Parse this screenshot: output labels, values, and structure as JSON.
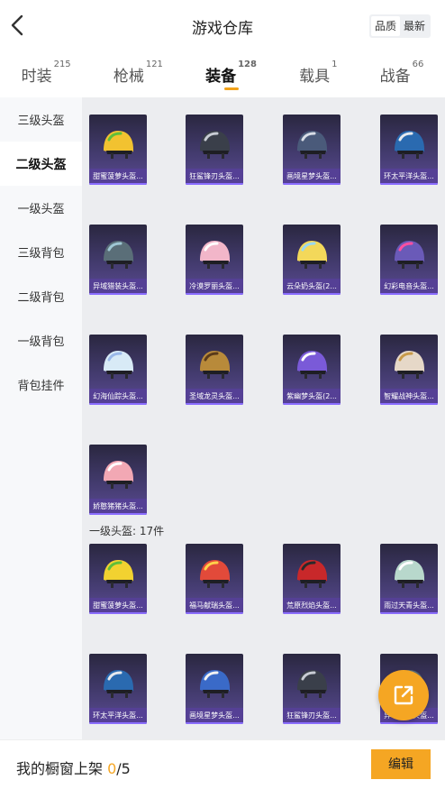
{
  "header": {
    "title": "游戏仓库",
    "sort": [
      {
        "label": "品质",
        "active": true
      },
      {
        "label": "最新",
        "active": false
      }
    ]
  },
  "tabs": [
    {
      "label": "时装",
      "count": "215",
      "active": false
    },
    {
      "label": "枪械",
      "count": "121",
      "active": false
    },
    {
      "label": "装备",
      "count": "128",
      "active": true
    },
    {
      "label": "载具",
      "count": "1",
      "active": false
    },
    {
      "label": "战备",
      "count": "66",
      "active": false
    }
  ],
  "sidebar": {
    "items": [
      {
        "label": "三级头盔",
        "active": false
      },
      {
        "label": "二级头盔",
        "active": true
      },
      {
        "label": "一级头盔",
        "active": false
      },
      {
        "label": "三级背包",
        "active": false
      },
      {
        "label": "二级背包",
        "active": false
      },
      {
        "label": "一级背包",
        "active": false
      },
      {
        "label": "背包挂件",
        "active": false
      }
    ]
  },
  "level2": {
    "items": [
      {
        "name": "甜蜜菠萝头盔...",
        "icon": "pineapple-helmet-icon",
        "color": "#f2c230",
        "accent": "#5fbf3a"
      },
      {
        "name": "狂鲨锋刃头盔...",
        "icon": "shark-helmet-icon",
        "color": "#3a3f4a",
        "accent": "#c8ccd4"
      },
      {
        "name": "画境星梦头盔...",
        "icon": "starry-helmet-icon",
        "color": "#4a5a7a",
        "accent": "#d8dde6"
      },
      {
        "name": "环太平洋头盔...",
        "icon": "pacific-helmet-icon",
        "color": "#2a6ab0",
        "accent": "#e6e9ee"
      },
      {
        "name": "异域猎装头盔...",
        "icon": "hunter-helmet-icon",
        "color": "#5a6e78",
        "accent": "#9fc7d4"
      },
      {
        "name": "冷漠罗丽头盔...",
        "icon": "lolita-helmet-icon",
        "color": "#f2b6c9",
        "accent": "#ffffff"
      },
      {
        "name": "云朵奶头盔(2...",
        "icon": "cloud-helmet-icon",
        "color": "#f3d85a",
        "accent": "#9ad8f0"
      },
      {
        "name": "幻彩电音头盔...",
        "icon": "neon-helmet-icon",
        "color": "#6a5ab8",
        "accent": "#ff4fa0"
      },
      {
        "name": "幻海仙踪头盔...",
        "icon": "sea-helmet-icon",
        "color": "#d8eaf6",
        "accent": "#9ab8e8"
      },
      {
        "name": "圣域龙灵头盔...",
        "icon": "dragon-helmet-icon",
        "color": "#b88a3a",
        "accent": "#5a3a1a"
      },
      {
        "name": "紫幽梦头盔(2...",
        "icon": "violet-helmet-icon",
        "color": "#7a5ad8",
        "accent": "#ffffff"
      },
      {
        "name": "智耀战神头盔...",
        "icon": "warrior-helmet-icon",
        "color": "#e6d8c8",
        "accent": "#c89a4a"
      },
      {
        "name": "娇憨猪猪头盔...",
        "icon": "pig-helmet-icon",
        "color": "#f2a8b4",
        "accent": "#ffffff"
      }
    ]
  },
  "level1": {
    "header": "一级头盔: 17件",
    "items": [
      {
        "name": "甜蜜菠萝头盔...",
        "icon": "pineapple-helmet-icon",
        "color": "#f2d230",
        "accent": "#5fbf3a"
      },
      {
        "name": "福马献瑞头盔...",
        "icon": "horse-helmet-icon",
        "color": "#e24a3a",
        "accent": "#ffd24a"
      },
      {
        "name": "荒原烈焰头盔...",
        "icon": "flame-helmet-icon",
        "color": "#c8282a",
        "accent": "#2a2a2a"
      },
      {
        "name": "雨过天青头盔...",
        "icon": "celadon-helmet-icon",
        "color": "#b8d8cc",
        "accent": "#ffffff"
      },
      {
        "name": "环太平洋头盔...",
        "icon": "pacific-helmet-icon",
        "color": "#2a6ab0",
        "accent": "#e6e9ee"
      },
      {
        "name": "画境星梦头盔...",
        "icon": "starry-helmet-icon",
        "color": "#3a6ac8",
        "accent": "#f2f2f2"
      },
      {
        "name": "狂鲨锋刃头盔...",
        "icon": "shark-helmet-icon",
        "color": "#3a3f4a",
        "accent": "#c8ccd4"
      },
      {
        "name": "异域猎装头盔...",
        "icon": "hunter-helmet-icon",
        "color": "#5a6e78",
        "accent": "#9fc7d4"
      }
    ]
  },
  "footer": {
    "showcase_label": "我的橱窗上架 ",
    "showcase_current": "0",
    "showcase_total": "/5",
    "edit_label": "编辑"
  }
}
